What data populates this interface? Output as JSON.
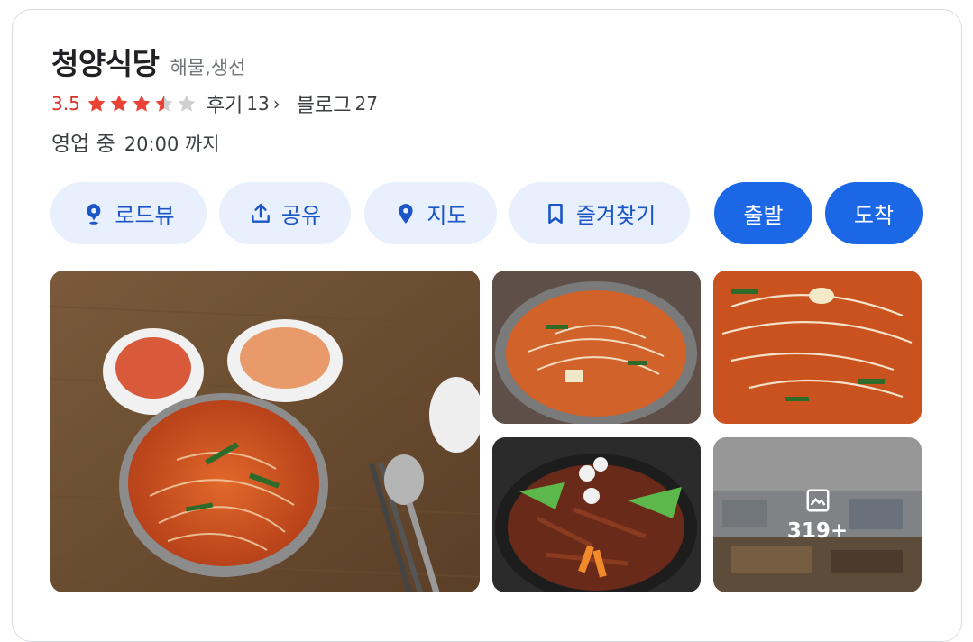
{
  "place": {
    "name": "청양식당",
    "category": "해물,생선",
    "rating": "3.5",
    "rating_value": 3.5,
    "rating_max": 5,
    "reviews_label": "후기",
    "reviews_count": "13",
    "chevron": "›",
    "blog_label": "블로그",
    "blog_count": "27",
    "open_status": "영업 중",
    "hours": "20:00 까지"
  },
  "actions": [
    {
      "label": "로드뷰",
      "icon": "roadview-pin-icon"
    },
    {
      "label": "공유",
      "icon": "share-icon"
    },
    {
      "label": "지도",
      "icon": "map-pin-icon"
    },
    {
      "label": "즐겨찾기",
      "icon": "bookmark-icon"
    },
    {
      "label": "출발"
    },
    {
      "label": "도착"
    }
  ],
  "photos": {
    "more_count": "319+",
    "more_icon": "gallery-icon"
  },
  "colors": {
    "accent": "#1b67e5",
    "accent_light": "#e8effd",
    "rating_red": "#d93025",
    "star_red": "#ea4335",
    "star_grey": "#d0d0d0"
  }
}
